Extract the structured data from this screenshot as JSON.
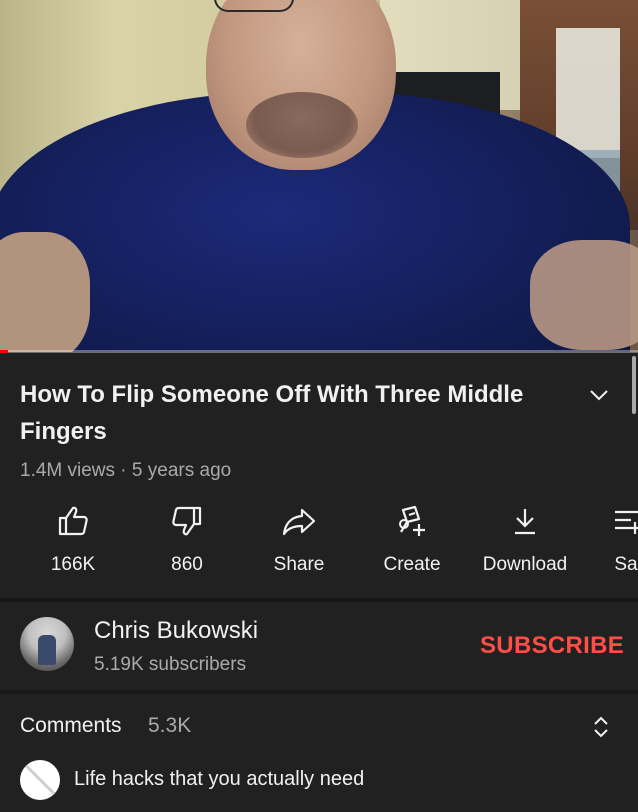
{
  "video": {
    "progress_fraction": 0.012,
    "scene_description_icon": "video-frame"
  },
  "title": "How To Flip Someone Off With Three Middle Fingers",
  "meta": "1.4M views · 5 years ago",
  "actions": [
    {
      "icon": "thumbs-up-icon",
      "label": "166K"
    },
    {
      "icon": "thumbs-down-icon",
      "label": "860"
    },
    {
      "icon": "share-icon",
      "label": "Share"
    },
    {
      "icon": "create-icon",
      "label": "Create"
    },
    {
      "icon": "download-icon",
      "label": "Download"
    },
    {
      "icon": "save-icon",
      "label": "Sa"
    }
  ],
  "channel": {
    "name": "Chris Bukowski",
    "subscribers": "5.19K subscribers",
    "subscribe_label": "SUBSCRIBE"
  },
  "comments": {
    "label": "Comments",
    "count": "5.3K",
    "top_comment": "Life hacks that you actually need"
  },
  "colors": {
    "background": "#212121",
    "subscribe": "#ff4e45",
    "progress": "#ff0000",
    "secondary_text": "#aaaaaa"
  }
}
